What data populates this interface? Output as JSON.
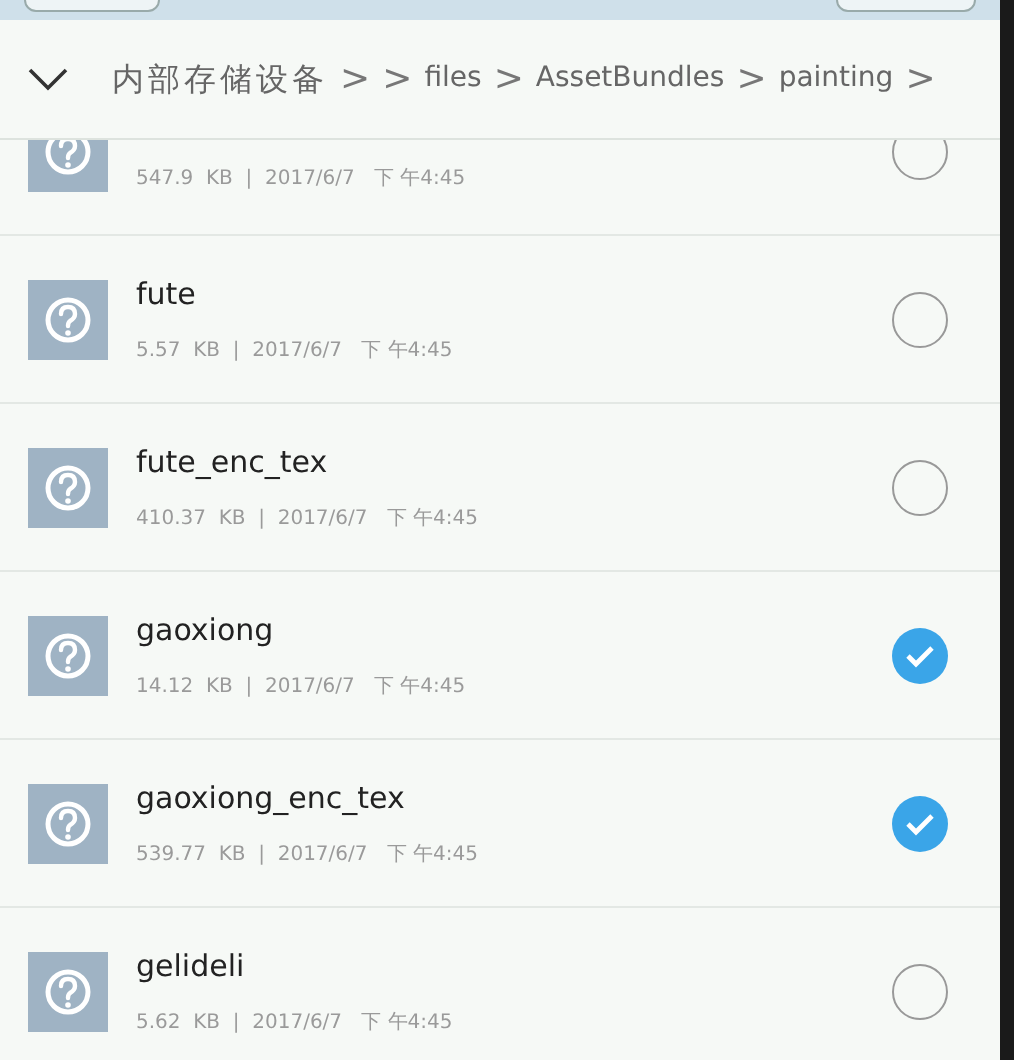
{
  "breadcrumb": [
    "内部存储设备",
    ">",
    ">",
    "files",
    ">",
    "AssetBundles",
    ">",
    "painting",
    ">"
  ],
  "files": [
    {
      "meta": "547.9  KB  |  2017/6/7   下 午4:45",
      "selected": false
    },
    {
      "name": "fute",
      "meta": "5.57  KB  |  2017/6/7   下 午4:45",
      "selected": false
    },
    {
      "name": "fute_enc_tex",
      "meta": "410.37  KB  |  2017/6/7   下 午4:45",
      "selected": false
    },
    {
      "name": "gaoxiong",
      "meta": "14.12  KB  |  2017/6/7   下 午4:45",
      "selected": true
    },
    {
      "name": "gaoxiong_enc_tex",
      "meta": "539.77  KB  |  2017/6/7   下 午4:45",
      "selected": true
    },
    {
      "name": "gelideli",
      "meta": "5.62  KB  |  2017/6/7   下 午4:45",
      "selected": false
    }
  ]
}
